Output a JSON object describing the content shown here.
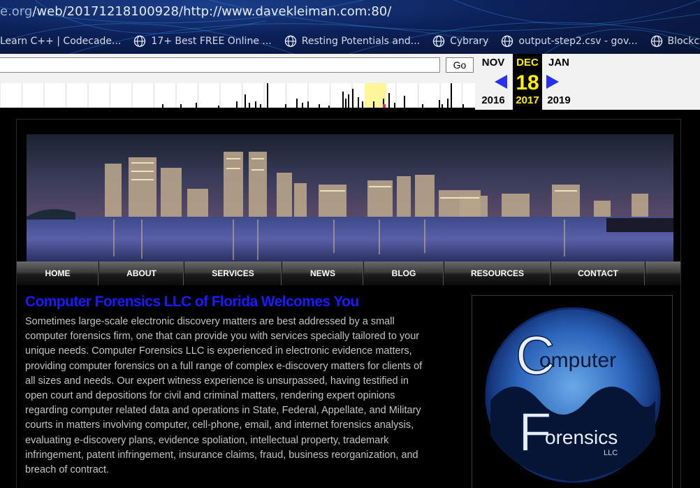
{
  "browser": {
    "url_prefix": "e.org",
    "url_rest": "/web/20171218100928/http://www.davekleiman.com:80/",
    "bookmarks": [
      {
        "label": "Learn C++ | Codecade...",
        "icon": "globe-icon"
      },
      {
        "label": "17+ Best FREE Online ...",
        "icon": "globe-icon"
      },
      {
        "label": "Resting Potentials and...",
        "icon": "globe-icon"
      },
      {
        "label": "Cybrary",
        "icon": "globe-icon"
      },
      {
        "label": "output-step2.csv - gov...",
        "icon": "globe-icon"
      },
      {
        "label": "Blockchain Enab",
        "icon": "globe-icon"
      }
    ]
  },
  "wayback": {
    "go_label": "Go",
    "search_value": "",
    "prev": {
      "month": "NOV",
      "year": "2016"
    },
    "current": {
      "month": "DEC",
      "day": "18",
      "year": "2017"
    },
    "next": {
      "month": "JAN",
      "year": "2019"
    },
    "accent": "#2a30f0",
    "highlight": "#ffef00"
  },
  "site": {
    "nav": [
      "HOME",
      "ABOUT",
      "SERVICES",
      "NEWS",
      "BLOG",
      "RESOURCES",
      "CONTACT"
    ],
    "welcome_title": "Computer Forensics LLC of Florida Welcomes You",
    "body": "Sometimes large-scale electronic discovery matters are best addressed by a small computer forensics firm, one that can provide you with services specially tailored to your unique needs. Computer Forensics LLC is experienced in electronic evidence matters, providing computer forensics on a full range of complex e-discovery matters for clients of all sizes and needs. Our expert witness experience is unsurpassed, having testified in open court and depositions for civil and criminal matters, rendering expert opinions regarding computer related data and operations in State, Federal, Appellate, and Military courts in matters involving computer, cell-phone, email, and internet forensics analysis, evaluating e-discovery plans, evidence spoliation, intellectual property, trademark infringement, patent infringement, insurance claims, fraud, business reorganization, and breach of contract.",
    "logo": {
      "line1": "omputer",
      "line2": "orensics",
      "line3": "LLC",
      "letter1": "C",
      "letter2": "F"
    },
    "title_color": "#1a1aff"
  }
}
